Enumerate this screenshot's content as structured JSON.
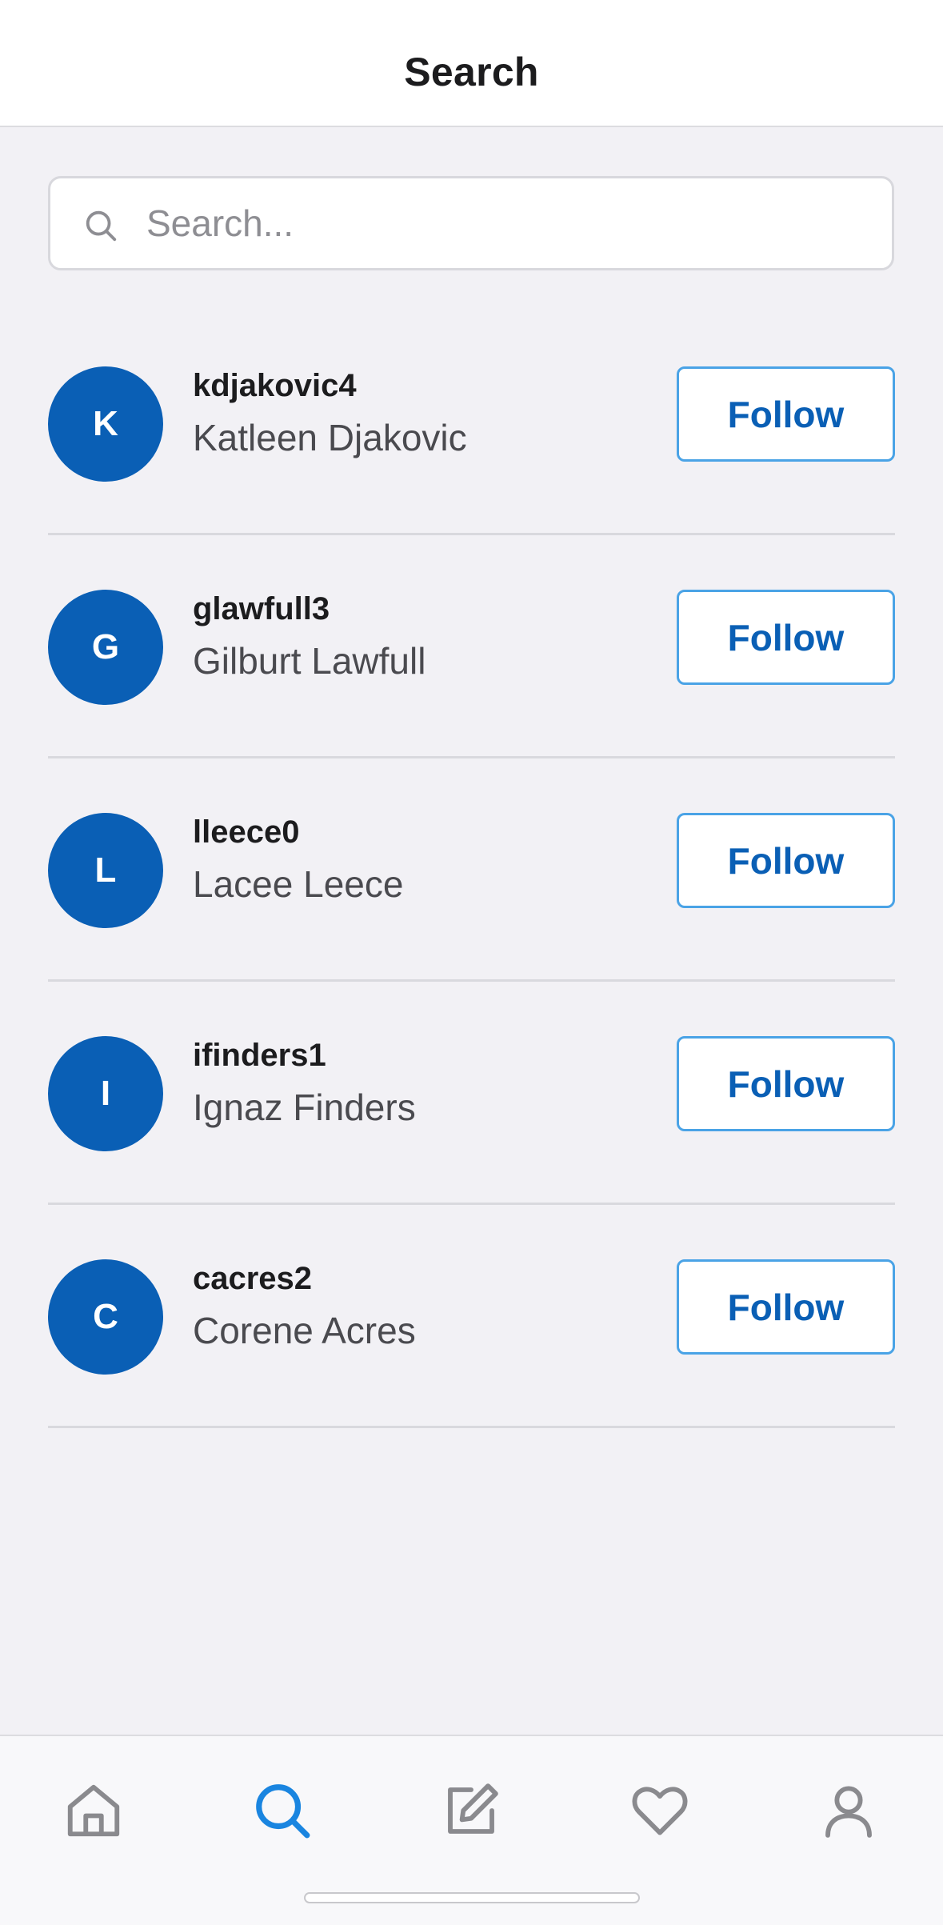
{
  "header": {
    "title": "Search"
  },
  "search": {
    "placeholder": "Search...",
    "value": ""
  },
  "results": [
    {
      "initial": "K",
      "username": "kdjakovic4",
      "name": "Katleen Djakovic",
      "action": "Follow"
    },
    {
      "initial": "G",
      "username": "glawfull3",
      "name": "Gilburt Lawfull",
      "action": "Follow"
    },
    {
      "initial": "L",
      "username": "lleece0",
      "name": "Lacee Leece",
      "action": "Follow"
    },
    {
      "initial": "I",
      "username": "ifinders1",
      "name": "Ignaz Finders",
      "action": "Follow"
    },
    {
      "initial": "C",
      "username": "cacres2",
      "name": "Corene Acres",
      "action": "Follow"
    }
  ],
  "tab_bar": {
    "active": "search",
    "tabs": [
      {
        "icon": "home-icon"
      },
      {
        "icon": "search-icon"
      },
      {
        "icon": "compose-icon"
      },
      {
        "icon": "heart-icon"
      },
      {
        "icon": "profile-icon"
      }
    ]
  },
  "colors": {
    "accent": "#0a5fb5",
    "active_tab": "#1a85e0",
    "inactive_tab": "#8a8a8e",
    "button_border": "#4aa3e6"
  }
}
